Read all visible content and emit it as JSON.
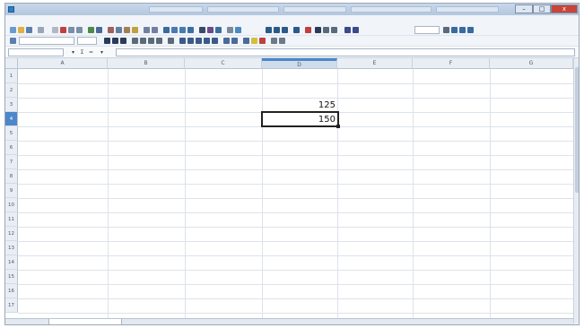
{
  "window": {
    "title": "",
    "buttons": {
      "minimize": "–",
      "maximize": "□",
      "close": "x"
    }
  },
  "menubar": {
    "items": []
  },
  "formula_bar": {
    "name_box": "",
    "content": ""
  },
  "sheet": {
    "columns": [
      "A",
      "B",
      "C",
      "D",
      "E",
      "F",
      "G"
    ],
    "rows": [
      "1",
      "2",
      "3",
      "4",
      "5",
      "6",
      "7",
      "8",
      "9",
      "10",
      "11",
      "12",
      "13",
      "14",
      "15",
      "16",
      "17"
    ],
    "selected_column": "D",
    "selected_row": "4",
    "cells": {
      "D3": "125",
      "D4": "150"
    }
  },
  "tabs": {
    "active": ""
  },
  "colors": {
    "accent": "#4c87c9",
    "close": "#c9443a"
  }
}
